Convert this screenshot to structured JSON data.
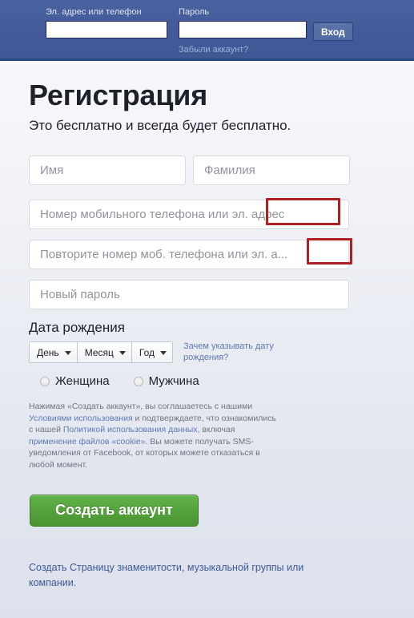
{
  "header": {
    "email_label": "Эл. адрес или телефон",
    "email_value": "",
    "email_placeholder": "",
    "password_label": "Пароль",
    "password_value": "",
    "password_placeholder": "",
    "login_button": "Вход",
    "forgot_link": "Забыли аккаунт?",
    "bar_color": "#44599a",
    "bar_border_color": "#29487d",
    "button_color": "#5b74a8",
    "label_color": "#dfe3ee",
    "forgot_link_color": "#9cb4d8"
  },
  "signup": {
    "title": "Регистрация",
    "subtitle": "Это бесплатно и всегда будет бесплатно.",
    "first_name_placeholder": "Имя",
    "first_name_value": "",
    "last_name_placeholder": "Фамилия",
    "last_name_value": "",
    "email_placeholder": "Номер мобильного телефона или эл. адрес",
    "email_value": "",
    "email_confirm_placeholder": "Повторите номер моб. телефона или эл. а...",
    "email_confirm_value": "",
    "password_placeholder": "Новый пароль",
    "password_value": "",
    "birthday": {
      "label": "Дата рождения",
      "day": "День",
      "month": "Месяц",
      "year": "Год",
      "why_link": "Зачем указывать дату рождения?"
    },
    "gender": {
      "female": "Женщина",
      "male": "Мужчина",
      "selected": ""
    },
    "legal": {
      "part1": "Нажимая «Создать аккаунт», вы соглашаетесь с нашими ",
      "terms_link": "Условиями использования",
      "part2": " и подтверждаете, что ознакомились с нашей ",
      "data_policy_link": "Политикой использования данных",
      "part3": ", включая ",
      "cookie_link": "применение файлов «cookie»",
      "part4": ". Вы можете получать SMS-уведомления от Facebook, от которых можете отказаться в любой момент."
    },
    "submit_button": "Создать аккаунт",
    "submit_color": "#55a23c",
    "footer_link": "Создать Страницу знаменитости, музыкальной группы или компании.",
    "footer_link_color": "#3b5998"
  },
  "annotations": {
    "highlight_color": "#b02020",
    "box1_text": "эл. адрес",
    "box2_text": "эл. а..."
  }
}
